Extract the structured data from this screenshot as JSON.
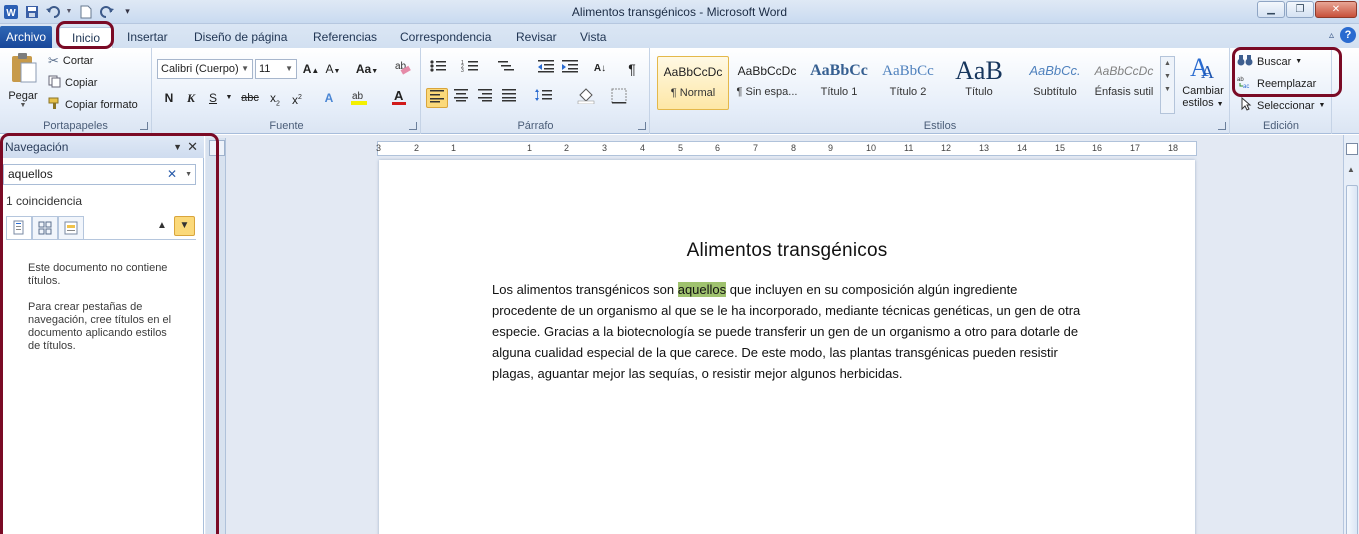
{
  "window": {
    "title": "Alimentos transgénicos  -  Microsoft Word",
    "quick_access": [
      "word-icon",
      "save-icon",
      "undo-icon",
      "new-doc-icon",
      "redo-icon",
      "customize-icon"
    ]
  },
  "tabs": {
    "file": "Archivo",
    "home": "Inicio",
    "insert": "Insertar",
    "design": "Diseño de página",
    "references": "Referencias",
    "mailings": "Correspondencia",
    "review": "Revisar",
    "view": "Vista"
  },
  "ribbon": {
    "clipboard": {
      "label": "Portapapeles",
      "paste": "Pegar",
      "cut": "Cortar",
      "copy": "Copiar",
      "format_painter": "Copiar formato"
    },
    "font": {
      "label": "Fuente",
      "font_name": "Calibri (Cuerpo)",
      "font_size": "11"
    },
    "paragraph": {
      "label": "Párrafo"
    },
    "styles": {
      "label": "Estilos",
      "items": [
        {
          "sample": "AaBbCcDc",
          "name": "¶ Normal"
        },
        {
          "sample": "AaBbCcDc",
          "name": "¶ Sin espa..."
        },
        {
          "sample": "AaBbCc",
          "name": "Título 1"
        },
        {
          "sample": "AaBbCc",
          "name": "Título 2"
        },
        {
          "sample": "AaB",
          "name": "Título"
        },
        {
          "sample": "AaBbCc.",
          "name": "Subtítulo"
        },
        {
          "sample": "AaBbCcDc",
          "name": "Énfasis sutil"
        }
      ],
      "change_styles_1": "Cambiar",
      "change_styles_2": "estilos"
    },
    "editing": {
      "label": "Edición",
      "find": "Buscar",
      "replace": "Reemplazar",
      "select": "Seleccionar"
    }
  },
  "navigation": {
    "title": "Navegación",
    "search_value": "aquellos",
    "match_count": "1 coincidencia",
    "message_1": "Este documento no contiene títulos.",
    "message_2": "Para crear pestañas de navegación, cree títulos en el documento aplicando estilos de títulos."
  },
  "ruler": {
    "numbers": [
      "3",
      "2",
      "1",
      "1",
      "2",
      "3",
      "4",
      "5",
      "6",
      "7",
      "8",
      "9",
      "10",
      "11",
      "12",
      "13",
      "14",
      "15",
      "16",
      "17",
      "18"
    ]
  },
  "document": {
    "title": "Alimentos transgénicos",
    "para_before": "Los alimentos transgénicos son ",
    "para_highlight": "aquellos",
    "para_after": " que incluyen en su composición algún ingrediente procedente de un organismo al que se le ha incorporado, mediante técnicas genéticas, un gen de otra especie. Gracias a la biotecnología se puede transferir un gen de un organismo a otro para dotarle de alguna cualidad especial de la que carece. De este modo, las plantas transgénicas pueden resistir plagas, aguantar mejor las sequías, o resistir mejor algunos herbicidas."
  },
  "colors": {
    "highlight_annotation": "#7a0a25",
    "file_tab": "#2a5caa",
    "search_highlight": "#9fc26e"
  }
}
